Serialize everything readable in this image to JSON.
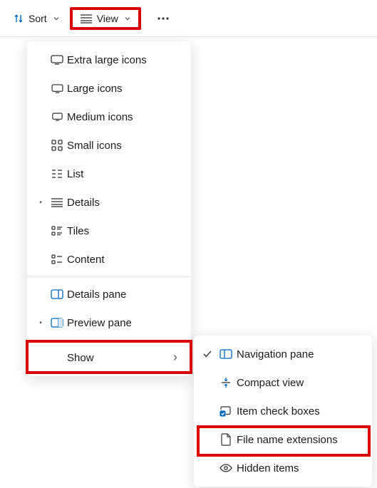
{
  "toolbar": {
    "sort_label": "Sort",
    "view_label": "View"
  },
  "menu": {
    "items": [
      {
        "label": "Extra large icons",
        "icon": "monitor-icon",
        "selected": false
      },
      {
        "label": "Large icons",
        "icon": "monitor-icon",
        "selected": false
      },
      {
        "label": "Medium icons",
        "icon": "monitor-icon",
        "selected": false
      },
      {
        "label": "Small icons",
        "icon": "grid-icon",
        "selected": false
      },
      {
        "label": "List",
        "icon": "list-icon",
        "selected": false
      },
      {
        "label": "Details",
        "icon": "details-icon",
        "selected": true
      },
      {
        "label": "Tiles",
        "icon": "tiles-icon",
        "selected": false
      },
      {
        "label": "Content",
        "icon": "content-icon",
        "selected": false
      }
    ],
    "panes": [
      {
        "label": "Details pane",
        "icon": "details-pane-icon",
        "selected": false
      },
      {
        "label": "Preview pane",
        "icon": "preview-pane-icon",
        "selected": true
      }
    ],
    "show_label": "Show"
  },
  "submenu": {
    "items": [
      {
        "label": "Navigation pane",
        "icon": "nav-pane-icon",
        "checked": true
      },
      {
        "label": "Compact view",
        "icon": "compact-icon",
        "checked": false
      },
      {
        "label": "Item check boxes",
        "icon": "checkboxes-icon",
        "checked": false
      },
      {
        "label": "File name extensions",
        "icon": "file-ext-icon",
        "checked": false
      },
      {
        "label": "Hidden items",
        "icon": "hidden-icon",
        "checked": false
      }
    ]
  }
}
